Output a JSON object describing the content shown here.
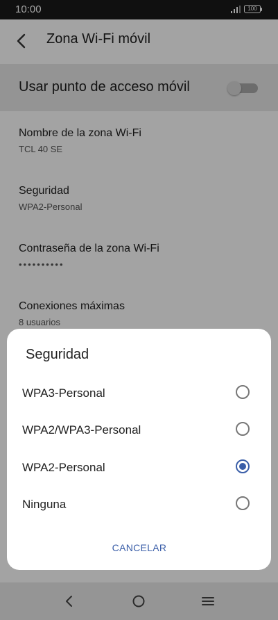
{
  "status_bar": {
    "time": "10:00",
    "battery": "100"
  },
  "header": {
    "title": "Zona Wi-Fi móvil",
    "back_icon": "chevron-left-icon"
  },
  "hotspot_toggle": {
    "label": "Usar punto de acceso móvil",
    "state": "off"
  },
  "settings": [
    {
      "name": "Nombre de la zona Wi-Fi",
      "value": "TCL 40 SE"
    },
    {
      "name": "Seguridad",
      "value": "WPA2-Personal"
    },
    {
      "name": "Contraseña de la zona Wi-Fi",
      "value": "••••••••••"
    },
    {
      "name": "Conexiones máximas",
      "value": "8 usuarios"
    }
  ],
  "dialog": {
    "title": "Seguridad",
    "options": [
      {
        "label": "WPA3-Personal",
        "selected": false
      },
      {
        "label": "WPA2/WPA3-Personal",
        "selected": false
      },
      {
        "label": "WPA2-Personal",
        "selected": true
      },
      {
        "label": "Ninguna",
        "selected": false
      }
    ],
    "cancel_label": "CANCELAR"
  },
  "nav_bar": {
    "back_icon": "back-icon",
    "home_icon": "home-icon",
    "menu_icon": "menu-icon"
  },
  "colors": {
    "accent": "#3a5ea8",
    "scrim": "rgba(0,0,0,0.36)"
  }
}
